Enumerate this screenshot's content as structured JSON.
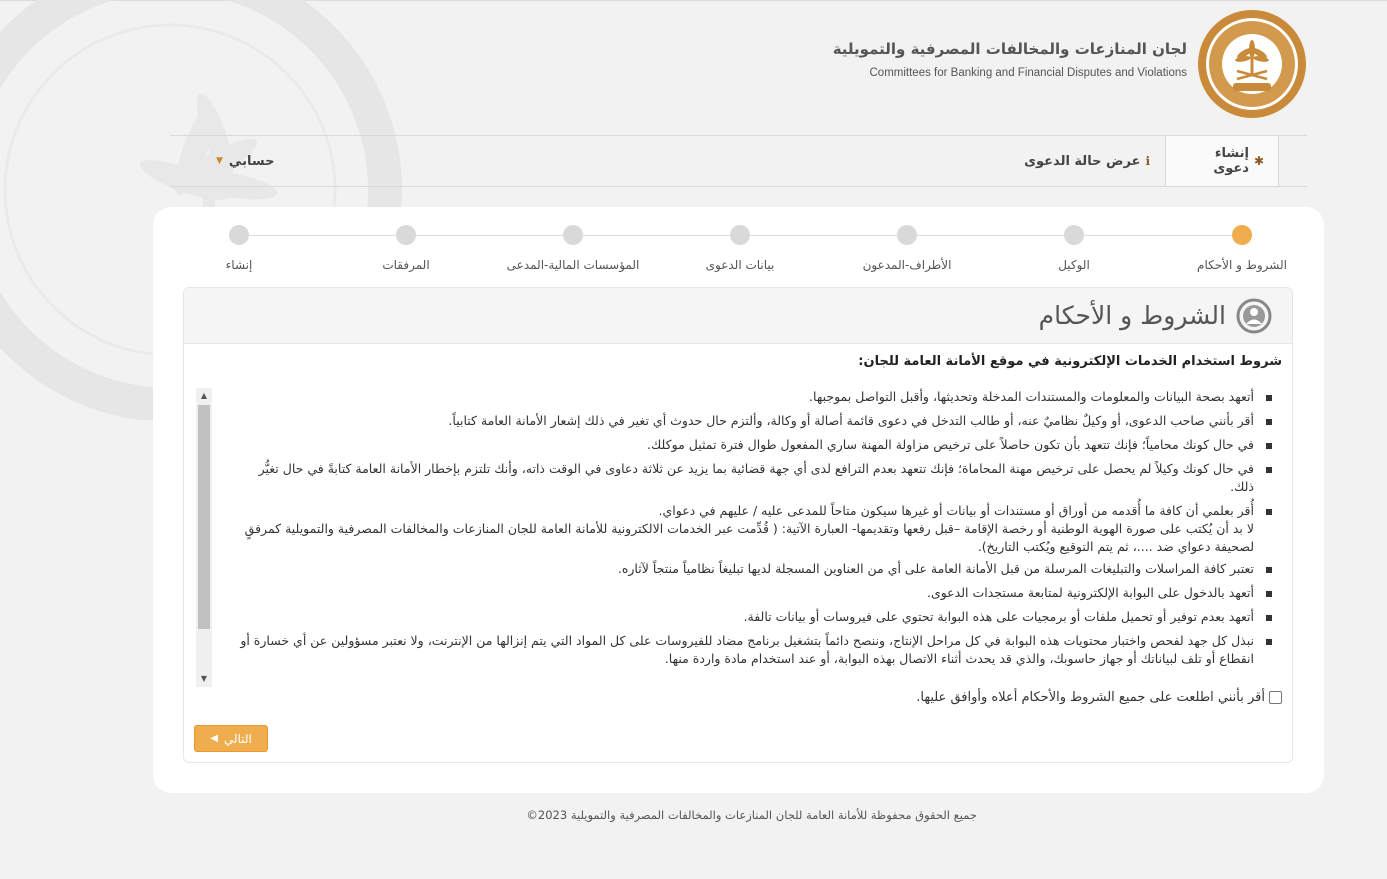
{
  "header": {
    "org_name_ar": "لجان المنازعات والمخالفات المصرفية والتمويلية",
    "org_name_en": "Committees for Banking and Financial Disputes and Violations"
  },
  "nav": {
    "create_case": "إنشاء دعوى",
    "view_case": "عرض حالة الدعوى",
    "account": "حسابي"
  },
  "steps": [
    {
      "label": "الشروط و الأحكام"
    },
    {
      "label": "الوكيل"
    },
    {
      "label": "الأطراف-المدعون"
    },
    {
      "label": "بيانات الدعوى"
    },
    {
      "label": "المؤسسات المالية-المدعى عليها"
    },
    {
      "label": "المرفقات"
    },
    {
      "label": "إنشاء"
    }
  ],
  "panel": {
    "title": "الشروط و الأحكام",
    "section_heading": "شروط استخدام الخدمات الإلكترونية في موقع الأمانة العامة للجان:",
    "terms": [
      "أتعهد بصحة البيانات والمعلومات والمستندات المدخلة وتحديثها، وأقبل التواصل بموجبها.",
      "أقر بأنني صاحب الدعوى، أو وكيلٌ نظاميٌ عنه، أو طالب التدخل في دعوى قائمة أصالة أو وكالة، وألتزم حال حدوث أي تغير في ذلك إشعار الأمانة العامة كتابياً.",
      "في حال كونك محامياً؛ فإنك تتعهد بأن تكون حاصلاً على ترخيص مزاولة المهنة ساري المفعول طوال فترة تمثيل موكلك.",
      "في حال كونك وكيلاً لم يحصل على ترخيص مهنة المحاماة؛ فإنك تتعهد بعدم الترافع لدى أي جهة قضائية بما يزيد عن ثلاثة دعاوى في الوقت ذاته، وأنك تلتزم بإخطار الأمانة العامة كتابةً في حال تغيُّر ذلك.",
      "أُقر بعلمي أن كافة ما أُقدمه من أوراق أو مستندات أو بيانات أو غيرها سيكون متاحاً للمدعى عليه / عليهم في دعواي.",
      "لا بد أن يُكتب على صورة الهوية الوطنية أو رخصة الإقامة –قبل رفعها وتقديمها- العبارة الآتية: ( قُدِّمت عبر الخدمات الالكترونية للأمانة العامة للجان المنازعات والمخالفات المصرفية والتمويلية كمرفقٍ لصحيفة دعواي ضد ....، ثم يتم التوقيع ويُكتب التاريخ).",
      "تعتبر كافة المراسلات والتبليغات المرسلة من قبل الأمانة العامة على أي من العناوين المسجلة لديها تبليغاً نظامياً منتجاً لآثاره.",
      "أتعهد بالدخول على البوابة الإلكترونية لمتابعة مستجدات الدعوى.",
      "أتعهد بعدم توفير أو تحميل ملفات أو برمجيات على هذه البوابة تحتوي على فيروسات أو بيانات تالفة.",
      "نبذل كل جهد لفحص واختبار محتويات هذه البوابة في كل مراحل الإنتاج، وننصح دائماً بتشغيل برنامج مضاد للفيروسات على كل المواد التي يتم إنزالها من الإنترنت، ولا نعتبر مسؤولين عن أي خسارة أو انقطاع أو تلف لبياناتك أو جهاز حاسوبك، والذي قد يحدث أثناء الاتصال بهذه البوابة، أو عند استخدام مادة واردة منها."
    ],
    "agree_label": "أقر بأنني اطلعت على جميع الشروط والأحكام أعلاه وأوافق عليها.",
    "next_label": "التالي"
  },
  "footer": {
    "copyright": "جميع الحقوق محفوظة للأمانة العامة للجان المنازعات والمخالفات المصرفية والتمويلية 2023©"
  },
  "colors": {
    "accent": "#f0ad4e",
    "brand_brown": "#8a5a22",
    "seal_gold": "#c98a3a"
  }
}
